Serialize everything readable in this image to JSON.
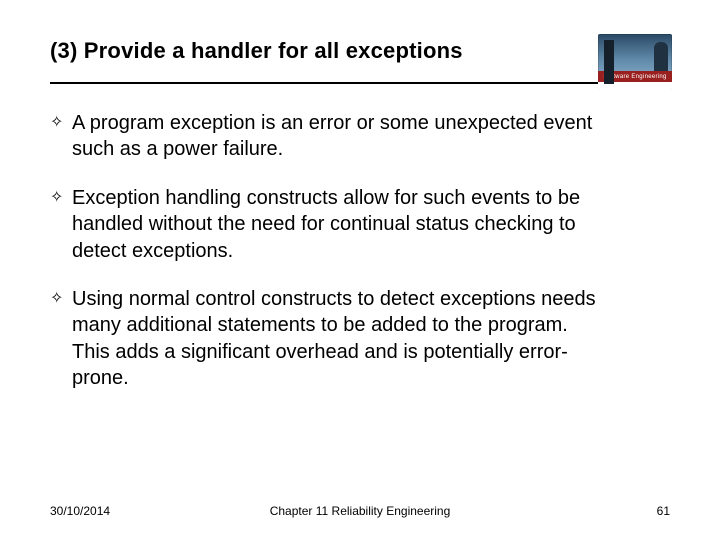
{
  "title": "(3) Provide a handler for all exceptions",
  "logo": {
    "band_text": "Software Engineering",
    "sub_text": ""
  },
  "bullets": [
    "A program exception is an error or some unexpected event such as a power failure.",
    "Exception handling constructs allow for such events to be handled without the need for continual status checking to detect exceptions.",
    "Using normal control constructs to detect exceptions needs many additional statements to be added to the program. This adds a significant overhead and is potentially error-prone."
  ],
  "bullet_symbol": "✧",
  "footer": {
    "date": "30/10/2014",
    "center": "Chapter 11 Reliability Engineering",
    "page": "61"
  }
}
